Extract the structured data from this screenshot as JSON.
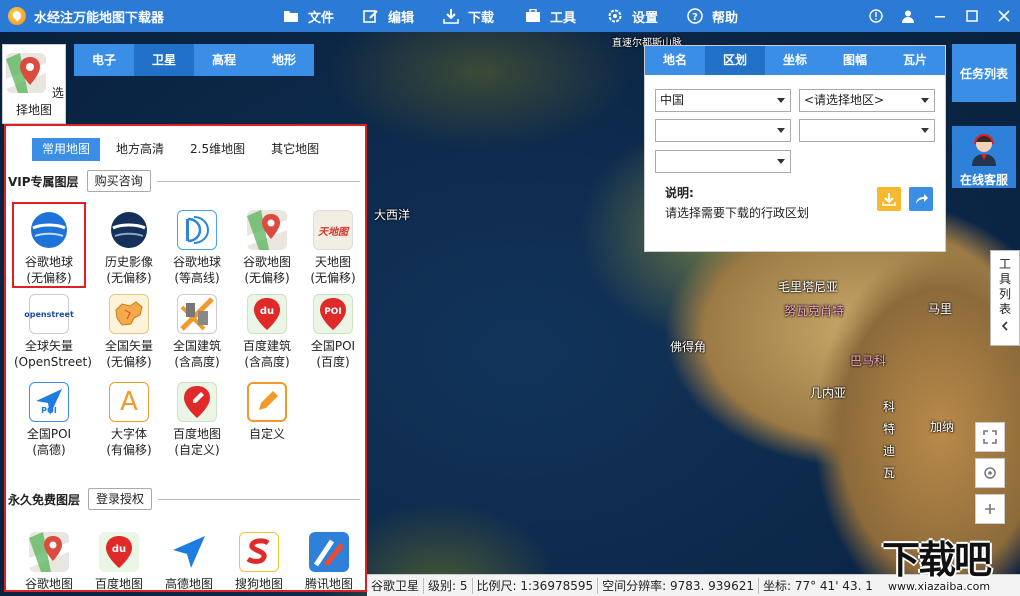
{
  "titlebar": {
    "title": "水经注万能地图下载器",
    "menu": [
      "文件",
      "编辑",
      "下载",
      "工具",
      "设置",
      "帮助"
    ]
  },
  "select_map": {
    "label": "选择地图"
  },
  "map_types": {
    "tabs": [
      "电子",
      "卫星",
      "高程",
      "地形"
    ],
    "active": "卫星"
  },
  "left_panel": {
    "source_tabs": [
      "常用地图",
      "地方高清",
      "2.5维地图",
      "其它地图"
    ],
    "vip_section": {
      "label": "VIP专属图层",
      "button": "购买咨询"
    },
    "vip_maps": [
      {
        "l1": "谷歌地球",
        "l2": "(无偏移)",
        "icon": "google-earth-icon"
      },
      {
        "l1": "历史影像",
        "l2": "(无偏移)",
        "icon": "history-image-icon"
      },
      {
        "l1": "谷歌地球",
        "l2": "(等高线)",
        "icon": "contour-icon"
      },
      {
        "l1": "谷歌地图",
        "l2": "(无偏移)",
        "icon": "google-maps-icon"
      },
      {
        "l1": "天地图",
        "l2": "(无偏移)",
        "icon": "tianditu-icon"
      },
      {
        "l1": "全球矢量",
        "l2": "(OpenStreet)",
        "icon": "openstreet-icon"
      },
      {
        "l1": "全国矢量",
        "l2": "(无偏移)",
        "icon": "china-vector-icon"
      },
      {
        "l1": "全国建筑",
        "l2": "(含高度)",
        "icon": "building-icon"
      },
      {
        "l1": "百度建筑",
        "l2": "(含高度)",
        "icon": "baidu-building-icon"
      },
      {
        "l1": "全国POI",
        "l2": "(百度)",
        "icon": "poi-baidu-icon"
      },
      {
        "l1": "全国POI",
        "l2": "(高德)",
        "icon": "poi-amap-icon"
      },
      {
        "l1": "大字体",
        "l2": "(有偏移)",
        "icon": "large-font-icon"
      },
      {
        "l1": "百度地图",
        "l2": "(自定义)",
        "icon": "baidu-custom-icon"
      },
      {
        "l1": "自定义",
        "l2": "",
        "icon": "custom-edit-icon"
      }
    ],
    "free_section": {
      "label": "永久免费图层",
      "button": "登录授权"
    },
    "free_maps": [
      {
        "l1": "谷歌地图",
        "icon": "google-maps-icon"
      },
      {
        "l1": "百度地图",
        "icon": "baidu-icon"
      },
      {
        "l1": "高德地图",
        "icon": "amap-icon"
      },
      {
        "l1": "搜狗地图",
        "icon": "sogou-icon"
      },
      {
        "l1": "腾讯地图",
        "icon": "tencent-icon"
      }
    ],
    "vip_badge_texts": {
      "tianditu": "天地图",
      "openstreet": "openstreet",
      "du": "du",
      "poi": "POI",
      "gugemap": "谷歌地"
    }
  },
  "region_panel": {
    "tabs": [
      "地名",
      "区划",
      "坐标",
      "图幅",
      "瓦片"
    ],
    "active": "区划",
    "country": "中国",
    "region_placeholder": "<请选择地区>",
    "note_title": "说明:",
    "note_text": "请选择需要下载的行政区划"
  },
  "side": {
    "task_list": "任务列表",
    "online_service": "在线客服",
    "tool_list": "工具列表"
  },
  "map_labels": {
    "ocean": "大西洋",
    "mauritania": "毛里塔尼亚",
    "mali": "马里",
    "nouakchott": "努瓦克肖特",
    "cape_verde": "佛得角",
    "bamako": "巴马科",
    "guinea": "几内亚",
    "cote_divoire": "科特迪瓦",
    "ghana": "加纳",
    "top_road": "直速尔都斯山脉"
  },
  "status": {
    "layer": "谷歌卫星",
    "level": "级别: 5",
    "scale": "比例尺: 1:36978595",
    "resolution": "空间分辨率: 9783. 939621",
    "coord": "坐标: 77° 41' 43. 1"
  },
  "watermark": {
    "main": "下载吧",
    "sub": "www.xiazaiba.com"
  },
  "colors": {
    "primary": "#2b7ad6",
    "tab_active": "#2271c9",
    "highlight": "#e02020"
  }
}
